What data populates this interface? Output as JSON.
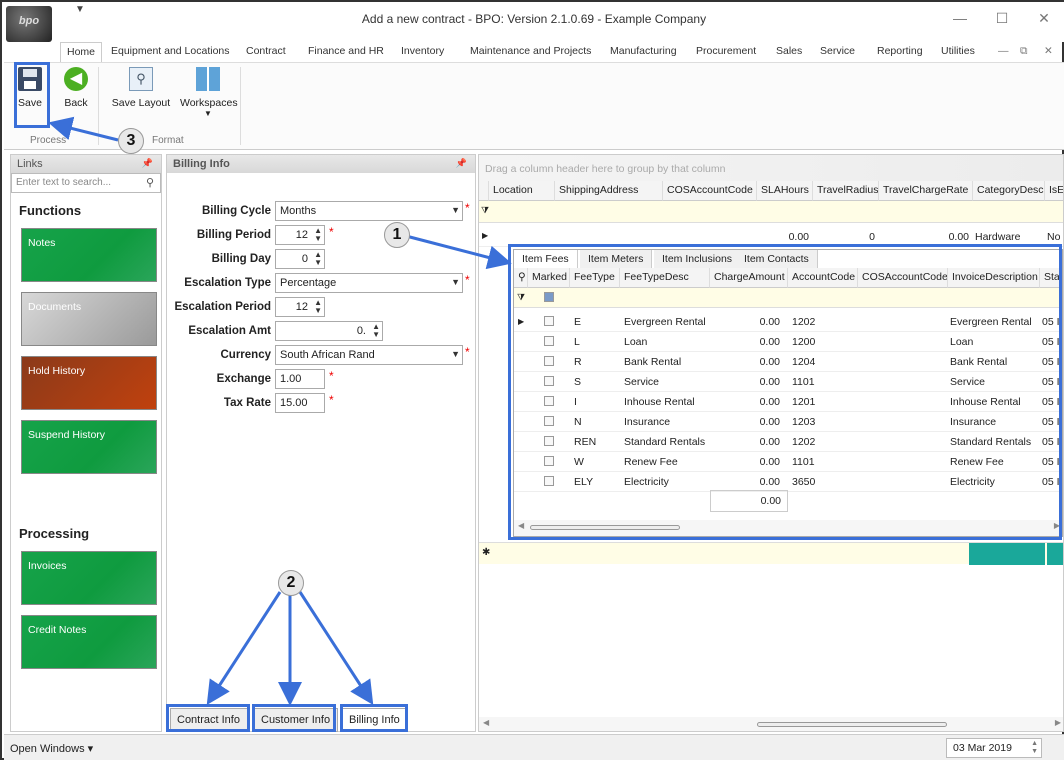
{
  "window": {
    "title": "Add a new contract - BPO: Version 2.1.0.69 - Example Company",
    "logo": "bpo",
    "quick_access": "▼"
  },
  "menu": [
    "Home",
    "Equipment and Locations",
    "Contract",
    "Finance and HR",
    "Inventory",
    "Maintenance and Projects",
    "Manufacturing",
    "Procurement",
    "Sales",
    "Service",
    "Reporting",
    "Utilities"
  ],
  "ribbon": {
    "save": "Save",
    "back": "Back",
    "save_layout": "Save Layout",
    "workspaces": "Workspaces",
    "group_process": "Process",
    "group_format": "Format"
  },
  "links": {
    "title": "Links",
    "search_placeholder": "Enter text to search...",
    "functions": "Functions",
    "processing": "Processing",
    "function_tiles": [
      "Notes",
      "Documents",
      "Hold History",
      "Suspend History"
    ],
    "processing_tiles": [
      "Invoices",
      "Credit Notes"
    ]
  },
  "billing": {
    "title": "Billing Info",
    "fields": [
      {
        "label": "Billing Cycle",
        "value": "Months"
      },
      {
        "label": "Billing Period",
        "value": "12"
      },
      {
        "label": "Billing Day",
        "value": "0"
      },
      {
        "label": "Escalation Type",
        "value": "Percentage"
      },
      {
        "label": "Escalation Period",
        "value": "12"
      },
      {
        "label": "Escalation Amt",
        "value": "0."
      },
      {
        "label": "Currency",
        "value": "South African Rand"
      },
      {
        "label": "Exchange",
        "value": "1.00"
      },
      {
        "label": "Tax Rate",
        "value": "15.00"
      }
    ],
    "tabs": [
      "Contract Info",
      "Customer Info",
      "Billing Info"
    ]
  },
  "grid": {
    "group_hint": "Drag a column header here to group by that column",
    "columns": [
      "Location",
      "ShippingAddress",
      "COSAccountCode",
      "SLAHours",
      "TravelRadius",
      "TravelChargeRate",
      "CategoryDesc",
      "IsE"
    ],
    "row": {
      "sla": "0.00",
      "radius": "0",
      "rate": "0.00",
      "category": "Hardware",
      "ise": "No"
    }
  },
  "subgrid": {
    "tabs": [
      "Item Fees",
      "Item Meters",
      "Item Inclusions",
      "Item Contacts"
    ],
    "columns": [
      "Marked",
      "FeeType",
      "FeeTypeDesc",
      "ChargeAmount",
      "AccountCode",
      "COSAccountCode",
      "InvoiceDescription",
      "Sta"
    ],
    "rows": [
      {
        "type": "E",
        "desc": "Evergreen Rental",
        "amount": "0.00",
        "account": "1202",
        "invoice": "Evergreen Rental",
        "sta": "05 I"
      },
      {
        "type": "L",
        "desc": "Loan",
        "amount": "0.00",
        "account": "1200",
        "invoice": "Loan",
        "sta": "05 I"
      },
      {
        "type": "R",
        "desc": "Bank Rental",
        "amount": "0.00",
        "account": "1204",
        "invoice": "Bank Rental",
        "sta": "05 I"
      },
      {
        "type": "S",
        "desc": "Service",
        "amount": "0.00",
        "account": "1101",
        "invoice": "Service",
        "sta": "05 I"
      },
      {
        "type": "I",
        "desc": "Inhouse Rental",
        "amount": "0.00",
        "account": "1201",
        "invoice": "Inhouse Rental",
        "sta": "05 I"
      },
      {
        "type": "N",
        "desc": "Insurance",
        "amount": "0.00",
        "account": "1203",
        "invoice": "Insurance",
        "sta": "05 I"
      },
      {
        "type": "REN",
        "desc": "Standard Rentals",
        "amount": "0.00",
        "account": "1202",
        "invoice": "Standard Rentals",
        "sta": "05 I"
      },
      {
        "type": "W",
        "desc": "Renew Fee",
        "amount": "0.00",
        "account": "1101",
        "invoice": "Renew Fee",
        "sta": "05 I"
      },
      {
        "type": "ELY",
        "desc": "Electricity",
        "amount": "0.00",
        "account": "3650",
        "invoice": "Electricity",
        "sta": "05 I"
      }
    ],
    "total": "0.00"
  },
  "status": {
    "open_windows": "Open Windows ▾",
    "date": "03 Mar 2019"
  },
  "annotations": [
    "1",
    "2",
    "3"
  ],
  "colors": {
    "accent": "#3a6fd8",
    "tile_green": "#16a34a"
  }
}
